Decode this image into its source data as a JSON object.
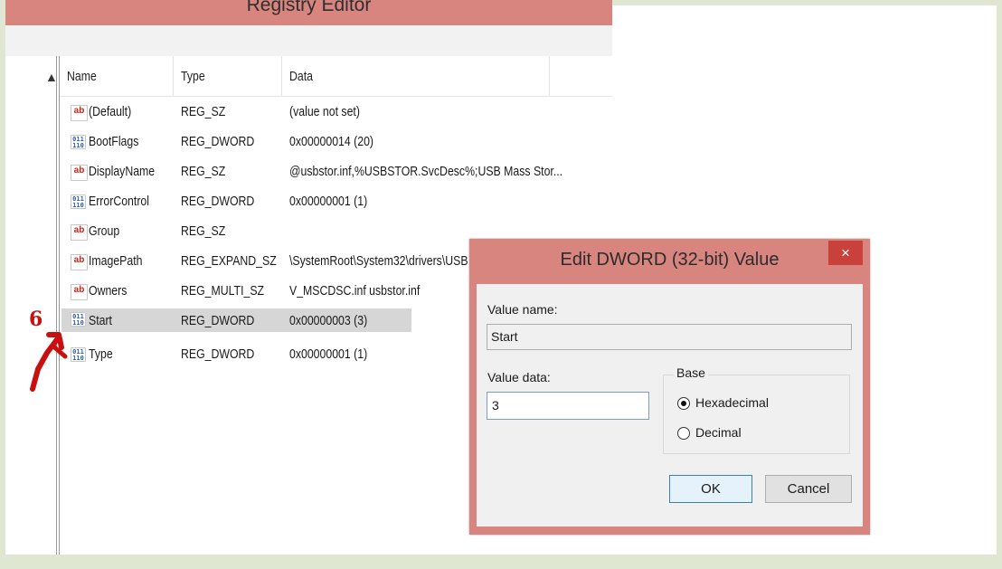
{
  "window": {
    "title": "Registry Editor"
  },
  "tree": {
    "scroll_up_icon": "▲"
  },
  "columns": {
    "name": "Name",
    "type": "Type",
    "data": "Data"
  },
  "rows": [
    {
      "icon": "string-value-icon",
      "icon_text": "ab",
      "name": "(Default)",
      "type": "REG_SZ",
      "data": "(value not set)"
    },
    {
      "icon": "binary-value-icon",
      "icon_text": "011 110",
      "name": "BootFlags",
      "type": "REG_DWORD",
      "data": "0x00000014 (20)"
    },
    {
      "icon": "string-value-icon",
      "icon_text": "ab",
      "name": "DisplayName",
      "type": "REG_SZ",
      "data": "@usbstor.inf,%USBSTOR.SvcDesc%;USB Mass Stor..."
    },
    {
      "icon": "binary-value-icon",
      "icon_text": "011 110",
      "name": "ErrorControl",
      "type": "REG_DWORD",
      "data": "0x00000001 (1)"
    },
    {
      "icon": "string-value-icon",
      "icon_text": "ab",
      "name": "Group",
      "type": "REG_SZ",
      "data": ""
    },
    {
      "icon": "string-value-icon",
      "icon_text": "ab",
      "name": "ImagePath",
      "type": "REG_EXPAND_SZ",
      "data": "\\SystemRoot\\System32\\drivers\\USB"
    },
    {
      "icon": "string-value-icon",
      "icon_text": "ab",
      "name": "Owners",
      "type": "REG_MULTI_SZ",
      "data": "V_MSCDSC.inf usbstor.inf"
    },
    {
      "icon": "binary-value-icon",
      "icon_text": "011 110",
      "name": "Start",
      "type": "REG_DWORD",
      "data": "0x00000003 (3)"
    },
    {
      "icon": "binary-value-icon",
      "icon_text": "011 110",
      "name": "Type",
      "type": "REG_DWORD",
      "data": "0x00000001 (1)"
    }
  ],
  "annotation": {
    "step": "6",
    "color": "#c81010"
  },
  "dialog": {
    "title": "Edit DWORD (32-bit) Value",
    "close_glyph": "×",
    "value_name_label": "Value name:",
    "value_name": "Start",
    "value_data_label": "Value data:",
    "value_data": "3",
    "base_label": "Base",
    "base_options": [
      "Hexadecimal",
      "Decimal"
    ],
    "base_selected": "Hexadecimal",
    "ok_label": "OK",
    "cancel_label": "Cancel"
  },
  "colors": {
    "titlebar": "#d8847f",
    "close_button": "#c8413a",
    "selected_row": "#d6d6d6",
    "frame": "#dfe6d2"
  }
}
